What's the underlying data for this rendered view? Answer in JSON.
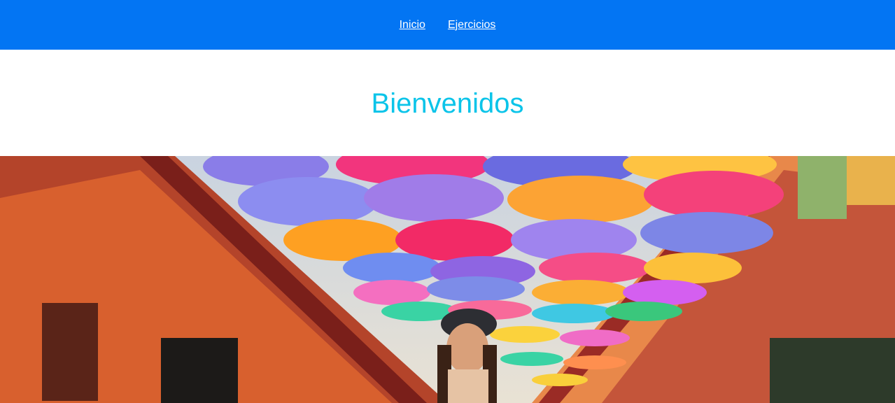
{
  "nav": {
    "items": [
      {
        "label": "Inicio"
      },
      {
        "label": "Ejercicios"
      }
    ]
  },
  "main": {
    "title": "Bienvenidos"
  },
  "colors": {
    "navbar": "#0375f3",
    "title": "#0bc4e9"
  }
}
